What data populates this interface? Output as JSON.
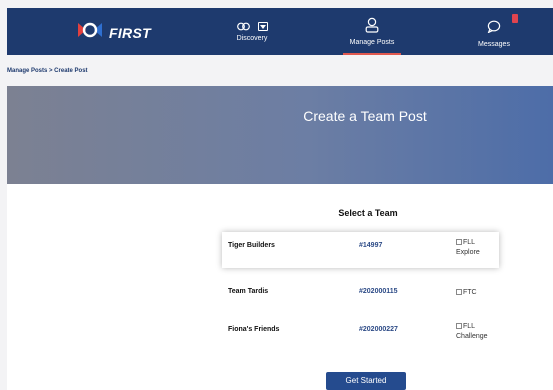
{
  "header": {
    "logo_text": "FIRST",
    "nav": {
      "discovery": "Discovery",
      "manage_posts": "Manage Posts",
      "messages": "Messages"
    }
  },
  "breadcrumb": "Manage Posts  >  Create Post",
  "hero": {
    "title": "Create a Team Post"
  },
  "select": {
    "title": "Select a Team",
    "teams": [
      {
        "name": "Tiger Builders",
        "number": "#14997",
        "program_line1": "FLL",
        "program_line2": "Explore"
      },
      {
        "name": "Team Tardis",
        "number": "#202000115",
        "program_line1": "FTC",
        "program_line2": ""
      },
      {
        "name": "Fiona's Friends",
        "number": "#202000227",
        "program_line1": "FLL",
        "program_line2": "Challenge"
      }
    ]
  },
  "actions": {
    "get_started": "Get Started"
  },
  "colors": {
    "navbar": "#1e3a6e",
    "accent": "#e0584f",
    "button": "#254b8e"
  }
}
